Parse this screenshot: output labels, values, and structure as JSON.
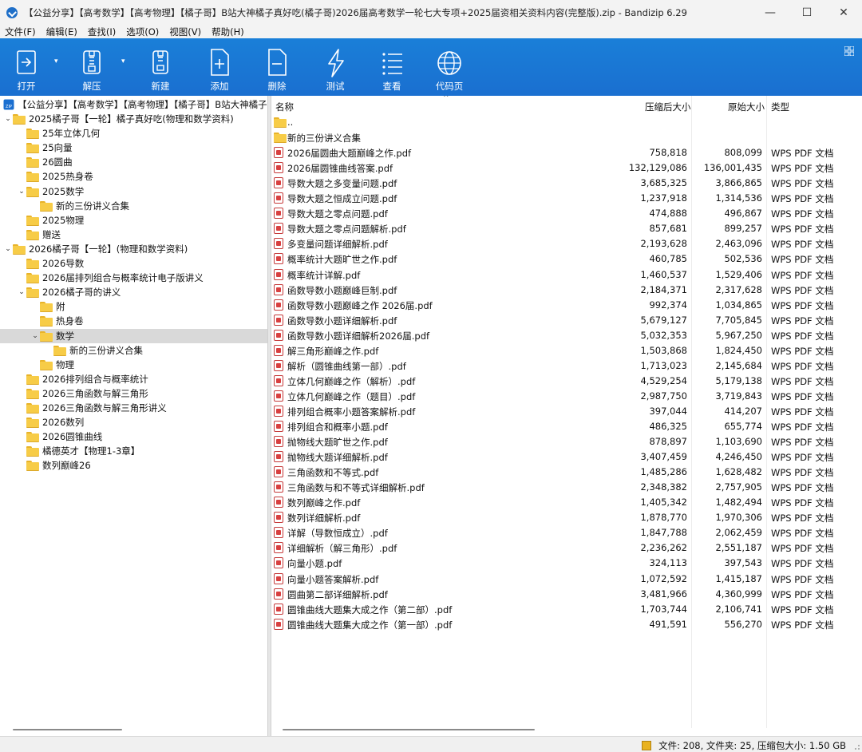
{
  "window": {
    "title": "【公益分享】【高考数学】【高考物理】【橘子哥】B站大神橘子真好吃(橘子哥)2026届高考数学一轮七大专项+2025届资相关资料内容(完整版).zip - Bandizip 6.29",
    "minimize": "—",
    "maximize": "☐",
    "close": "✕"
  },
  "menu": [
    "文件(F)",
    "编辑(E)",
    "查找(I)",
    "选项(O)",
    "视图(V)",
    "帮助(H)"
  ],
  "toolbar": {
    "buttons": [
      {
        "label": "打开",
        "icon": "open-icon"
      },
      {
        "label": "解压",
        "icon": "extract-icon"
      },
      {
        "label": "新建",
        "icon": "new-archive-icon"
      },
      {
        "label": "添加",
        "icon": "add-icon"
      },
      {
        "label": "删除",
        "icon": "delete-icon"
      },
      {
        "label": "测试",
        "icon": "test-icon"
      },
      {
        "label": "查看",
        "icon": "view-icon"
      },
      {
        "label": "代码页",
        "icon": "codepage-icon"
      }
    ],
    "dropdown": "▾",
    "accent": "#1a78d6"
  },
  "tree": {
    "root": "【公益分享】【高考数学】【高考物理】【橘子哥】B站大神橘子",
    "items": [
      {
        "label": "2025橘子哥【一轮】橘子真好吃(物理和数学资料)",
        "level": 0,
        "expanded": true
      },
      {
        "label": "25年立体几何",
        "level": 1
      },
      {
        "label": "25向量",
        "level": 1
      },
      {
        "label": "26圆曲",
        "level": 1
      },
      {
        "label": "2025热身卷",
        "level": 1
      },
      {
        "label": "2025数学",
        "level": 1,
        "expanded": true
      },
      {
        "label": "新的三份讲义合集",
        "level": 2
      },
      {
        "label": "2025物理",
        "level": 1
      },
      {
        "label": "赠送",
        "level": 1
      },
      {
        "label": "2026橘子哥【一轮】(物理和数学资料)",
        "level": 0,
        "expanded": true
      },
      {
        "label": "2026导数",
        "level": 1
      },
      {
        "label": "2026届排列组合与概率统计电子版讲义",
        "level": 1
      },
      {
        "label": "2026橘子哥的讲义",
        "level": 1,
        "expanded": true
      },
      {
        "label": "附",
        "level": 2
      },
      {
        "label": "热身卷",
        "level": 2
      },
      {
        "label": "数学",
        "level": 2,
        "expanded": true,
        "selected": true
      },
      {
        "label": "新的三份讲义合集",
        "level": 3
      },
      {
        "label": "物理",
        "level": 2
      },
      {
        "label": "2026排列组合与概率统计",
        "level": 1
      },
      {
        "label": "2026三角函数与解三角形",
        "level": 1
      },
      {
        "label": "2026三角函数与解三角形讲义",
        "level": 1
      },
      {
        "label": "2026数列",
        "level": 1
      },
      {
        "label": "2026圆锥曲线",
        "level": 1
      },
      {
        "label": "橘德英才【物理1-3章】",
        "level": 1
      },
      {
        "label": "数列巅峰26",
        "level": 1
      }
    ]
  },
  "list": {
    "columns": {
      "name": "名称",
      "packed": "压缩后大小",
      "original": "原始大小",
      "type": "类型"
    },
    "sort_caret": "^",
    "rows": [
      {
        "kind": "folder",
        "name": "..",
        "packed": "",
        "original": "",
        "type": ""
      },
      {
        "kind": "folder",
        "name": "新的三份讲义合集",
        "packed": "",
        "original": "",
        "type": ""
      },
      {
        "kind": "pdf",
        "name": "2026届圆曲大题巅峰之作.pdf",
        "packed": "758,818",
        "original": "808,099",
        "type": "WPS PDF 文档"
      },
      {
        "kind": "pdf",
        "name": "2026届圆锥曲线答案.pdf",
        "packed": "132,129,086",
        "original": "136,001,435",
        "type": "WPS PDF 文档"
      },
      {
        "kind": "pdf",
        "name": "导数大题之多变量问题.pdf",
        "packed": "3,685,325",
        "original": "3,866,865",
        "type": "WPS PDF 文档"
      },
      {
        "kind": "pdf",
        "name": "导数大题之恒成立问题.pdf",
        "packed": "1,237,918",
        "original": "1,314,536",
        "type": "WPS PDF 文档"
      },
      {
        "kind": "pdf",
        "name": "导数大题之零点问题.pdf",
        "packed": "474,888",
        "original": "496,867",
        "type": "WPS PDF 文档"
      },
      {
        "kind": "pdf",
        "name": "导数大题之零点问题解析.pdf",
        "packed": "857,681",
        "original": "899,257",
        "type": "WPS PDF 文档"
      },
      {
        "kind": "pdf",
        "name": "多变量问题详细解析.pdf",
        "packed": "2,193,628",
        "original": "2,463,096",
        "type": "WPS PDF 文档"
      },
      {
        "kind": "pdf",
        "name": "概率统计大题旷世之作.pdf",
        "packed": "460,785",
        "original": "502,536",
        "type": "WPS PDF 文档"
      },
      {
        "kind": "pdf",
        "name": "概率统计详解.pdf",
        "packed": "1,460,537",
        "original": "1,529,406",
        "type": "WPS PDF 文档"
      },
      {
        "kind": "pdf",
        "name": "函数导数小题巅峰巨制.pdf",
        "packed": "2,184,371",
        "original": "2,317,628",
        "type": "WPS PDF 文档"
      },
      {
        "kind": "pdf",
        "name": "函数导数小题巅峰之作 2026届.pdf",
        "packed": "992,374",
        "original": "1,034,865",
        "type": "WPS PDF 文档"
      },
      {
        "kind": "pdf",
        "name": "函数导数小题详细解析.pdf",
        "packed": "5,679,127",
        "original": "7,705,845",
        "type": "WPS PDF 文档"
      },
      {
        "kind": "pdf",
        "name": "函数导数小题详细解析2026届.pdf",
        "packed": "5,032,353",
        "original": "5,967,250",
        "type": "WPS PDF 文档"
      },
      {
        "kind": "pdf",
        "name": "解三角形巅峰之作.pdf",
        "packed": "1,503,868",
        "original": "1,824,450",
        "type": "WPS PDF 文档"
      },
      {
        "kind": "pdf",
        "name": "解析（圆锥曲线第一部）.pdf",
        "packed": "1,713,023",
        "original": "2,145,684",
        "type": "WPS PDF 文档"
      },
      {
        "kind": "pdf",
        "name": "立体几何巅峰之作（解析）.pdf",
        "packed": "4,529,254",
        "original": "5,179,138",
        "type": "WPS PDF 文档"
      },
      {
        "kind": "pdf",
        "name": "立体几何巅峰之作（题目）.pdf",
        "packed": "2,987,750",
        "original": "3,719,843",
        "type": "WPS PDF 文档"
      },
      {
        "kind": "pdf",
        "name": "排列组合概率小题答案解析.pdf",
        "packed": "397,044",
        "original": "414,207",
        "type": "WPS PDF 文档"
      },
      {
        "kind": "pdf",
        "name": "排列组合和概率小题.pdf",
        "packed": "486,325",
        "original": "655,774",
        "type": "WPS PDF 文档"
      },
      {
        "kind": "pdf",
        "name": "抛物线大题旷世之作.pdf",
        "packed": "878,897",
        "original": "1,103,690",
        "type": "WPS PDF 文档"
      },
      {
        "kind": "pdf",
        "name": "抛物线大题详细解析.pdf",
        "packed": "3,407,459",
        "original": "4,246,450",
        "type": "WPS PDF 文档"
      },
      {
        "kind": "pdf",
        "name": "三角函数和不等式.pdf",
        "packed": "1,485,286",
        "original": "1,628,482",
        "type": "WPS PDF 文档"
      },
      {
        "kind": "pdf",
        "name": "三角函数与和不等式详细解析.pdf",
        "packed": "2,348,382",
        "original": "2,757,905",
        "type": "WPS PDF 文档"
      },
      {
        "kind": "pdf",
        "name": "数列巅峰之作.pdf",
        "packed": "1,405,342",
        "original": "1,482,494",
        "type": "WPS PDF 文档"
      },
      {
        "kind": "pdf",
        "name": "数列详细解析.pdf",
        "packed": "1,878,770",
        "original": "1,970,306",
        "type": "WPS PDF 文档"
      },
      {
        "kind": "pdf",
        "name": "详解（导数恒成立）.pdf",
        "packed": "1,847,788",
        "original": "2,062,459",
        "type": "WPS PDF 文档"
      },
      {
        "kind": "pdf",
        "name": "详细解析（解三角形）.pdf",
        "packed": "2,236,262",
        "original": "2,551,187",
        "type": "WPS PDF 文档"
      },
      {
        "kind": "pdf",
        "name": "向量小题.pdf",
        "packed": "324,113",
        "original": "397,543",
        "type": "WPS PDF 文档"
      },
      {
        "kind": "pdf",
        "name": "向量小题答案解析.pdf",
        "packed": "1,072,592",
        "original": "1,415,187",
        "type": "WPS PDF 文档"
      },
      {
        "kind": "pdf",
        "name": "圆曲第二部详细解析.pdf",
        "packed": "3,481,966",
        "original": "4,360,999",
        "type": "WPS PDF 文档"
      },
      {
        "kind": "pdf",
        "name": "圆锥曲线大题集大成之作（第二部）.pdf",
        "packed": "1,703,744",
        "original": "2,106,741",
        "type": "WPS PDF 文档"
      },
      {
        "kind": "pdf",
        "name": "圆锥曲线大题集大成之作（第一部）.pdf",
        "packed": "491,591",
        "original": "556,270",
        "type": "WPS PDF 文档"
      }
    ]
  },
  "status": {
    "text": "文件: 208, 文件夹: 25, 压缩包大小: 1.50 GB"
  }
}
